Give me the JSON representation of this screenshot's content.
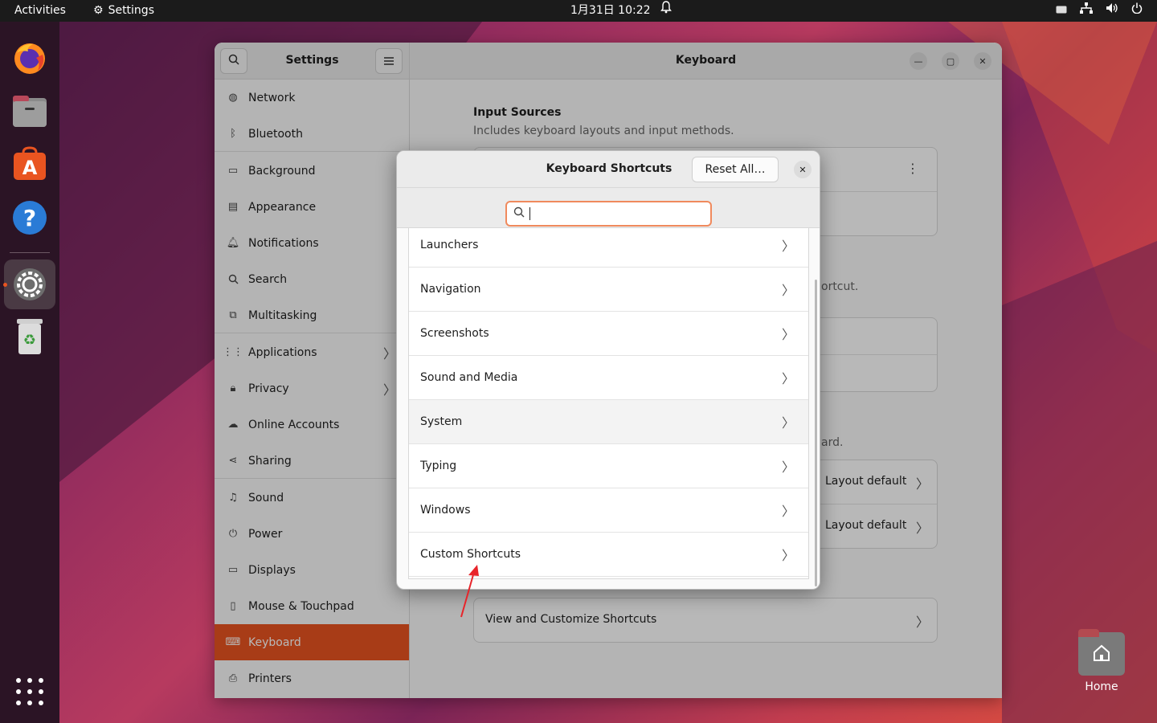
{
  "topbar": {
    "activities": "Activities",
    "app_name": "Settings",
    "clock": "1月31日  10:22"
  },
  "dock": {
    "items": [
      "firefox-icon",
      "files-icon",
      "app-center-icon",
      "help-icon",
      "settings-icon",
      "trash-icon"
    ],
    "active": "settings-icon",
    "show_apps": "apps-grid-icon"
  },
  "desktop": {
    "home_label": "Home"
  },
  "settings": {
    "sidebar_title": "Settings",
    "main_title": "Keyboard",
    "sidebar_items": [
      {
        "label": "Network",
        "icon": "network-icon"
      },
      {
        "label": "Bluetooth",
        "icon": "bluetooth-icon"
      },
      {
        "label": "Background",
        "icon": "background-icon"
      },
      {
        "label": "Appearance",
        "icon": "appearance-icon"
      },
      {
        "label": "Notifications",
        "icon": "bell-icon"
      },
      {
        "label": "Search",
        "icon": "search-icon"
      },
      {
        "label": "Multitasking",
        "icon": "multitasking-icon"
      },
      {
        "label": "Applications",
        "icon": "apps-icon"
      },
      {
        "label": "Privacy",
        "icon": "lock-icon"
      },
      {
        "label": "Online Accounts",
        "icon": "cloud-icon"
      },
      {
        "label": "Sharing",
        "icon": "share-icon"
      },
      {
        "label": "Sound",
        "icon": "music-note-icon"
      },
      {
        "label": "Power",
        "icon": "power-icon"
      },
      {
        "label": "Displays",
        "icon": "display-icon"
      },
      {
        "label": "Mouse & Touchpad",
        "icon": "mouse-icon"
      },
      {
        "label": "Keyboard",
        "icon": "keyboard-icon"
      },
      {
        "label": "Printers",
        "icon": "printer-icon"
      }
    ],
    "active_item": "Keyboard",
    "input_sources_title": "Input Sources",
    "input_sources_desc": "Includes keyboard layouts and input methods.",
    "fragment_shortcut": "ortcut.",
    "fragment_board": "ard.",
    "layout_default_1": "Layout default",
    "layout_default_2": "Layout default",
    "view_shortcuts": "View and Customize Shortcuts"
  },
  "dialog": {
    "title": "Keyboard Shortcuts",
    "reset_label": "Reset All…",
    "search_value": "",
    "categories": [
      "Launchers",
      "Navigation",
      "Screenshots",
      "Sound and Media",
      "System",
      "Typing",
      "Windows",
      "Custom Shortcuts"
    ],
    "highlighted": "System"
  },
  "colors": {
    "accent": "#e95420",
    "search_focus": "#f08a5d",
    "annotation_arrow": "#e8242a"
  }
}
